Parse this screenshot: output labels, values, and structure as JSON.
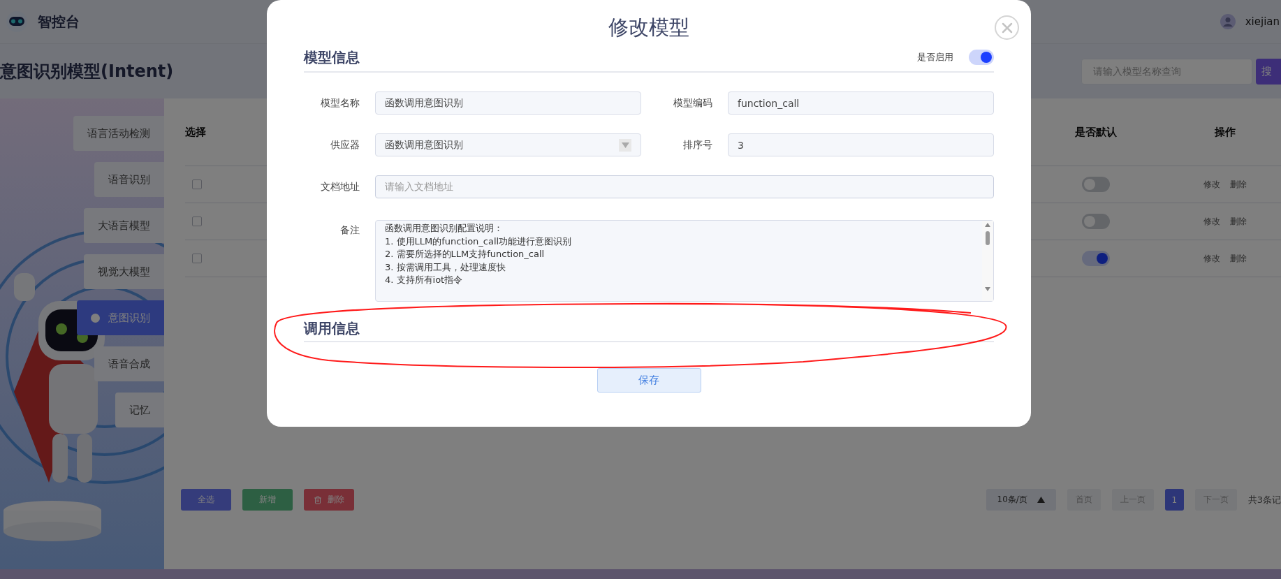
{
  "header": {
    "logo_text": "智控台",
    "user": "xiejian"
  },
  "page": {
    "title": "意图识别模型(Intent)",
    "search": {
      "placeholder": "请输入模型名称查询"
    },
    "search_button": "搜"
  },
  "sidebar": {
    "items": [
      {
        "label": "语言活动检测",
        "selected": false
      },
      {
        "label": "语音识别",
        "selected": false
      },
      {
        "label": "大语言模型",
        "selected": false
      },
      {
        "label": "视觉大模型",
        "selected": false
      },
      {
        "label": "意图识别",
        "selected": true
      },
      {
        "label": "语音合成",
        "selected": false
      },
      {
        "label": "记忆",
        "selected": false
      }
    ]
  },
  "table": {
    "columns": [
      "选择",
      "是否默认",
      "操作"
    ],
    "rows": [
      {
        "checked": false,
        "default": false,
        "actions": [
          "修改",
          "删除"
        ]
      },
      {
        "checked": false,
        "default": false,
        "actions": [
          "修改",
          "删除"
        ]
      },
      {
        "checked": false,
        "default": true,
        "actions": [
          "修改",
          "删除"
        ]
      }
    ]
  },
  "footer": {
    "buttons": [
      {
        "label": "全选",
        "kind": "select-all"
      },
      {
        "label": "新增",
        "kind": "add"
      },
      {
        "label": "删除",
        "kind": "delete"
      }
    ],
    "page_size": "10条/页",
    "pagination": [
      {
        "label": "首页",
        "kind": "nav",
        "selected": false
      },
      {
        "label": "上一页",
        "kind": "nav",
        "selected": false
      },
      {
        "label": "1",
        "kind": "page",
        "selected": true
      },
      {
        "label": "下一页",
        "kind": "nav",
        "selected": false
      }
    ],
    "total": "共3条记"
  },
  "modal": {
    "title": "修改模型",
    "section_1": {
      "title": "模型信息",
      "toggle_label": "是否启用",
      "enabled": true
    },
    "fields": [
      {
        "label": "模型名称",
        "kind": "text",
        "value": "函数调用意图识别"
      },
      {
        "label": "模型编码",
        "kind": "text",
        "value": "function_call"
      },
      {
        "label": "供应器",
        "kind": "select",
        "value": "函数调用意图识别"
      },
      {
        "label": "排序号",
        "kind": "text",
        "value": "3"
      },
      {
        "label": "文档地址",
        "kind": "wide",
        "placeholder": "请输入文档地址"
      }
    ],
    "remark": {
      "label": "备注",
      "lines": [
        "函数调用意图识别配置说明：",
        "1. 使用LLM的function_call功能进行意图识别",
        "2. 需要所选择的LLM支持function_call",
        "3. 按需调用工具，处理速度快",
        "4. 支持所有iot指令"
      ]
    },
    "section_2": {
      "title": "调用信息"
    },
    "save_button": "保存"
  },
  "annotations": [
    {
      "kind": "ellipse"
    }
  ]
}
